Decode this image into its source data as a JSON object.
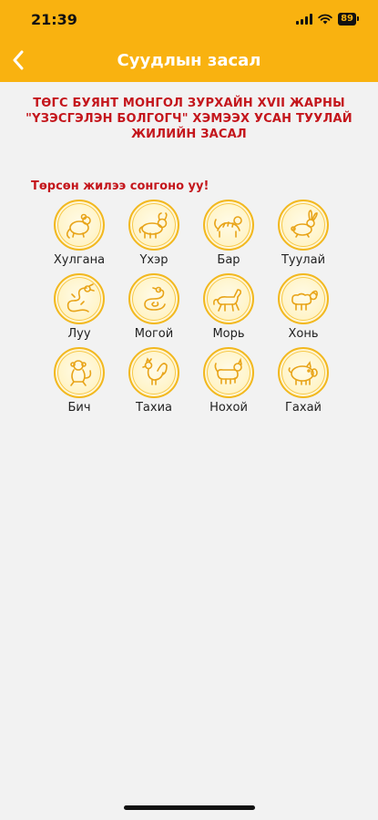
{
  "status_bar": {
    "time": "21:39",
    "battery": "89"
  },
  "nav": {
    "title": "Суудлын засал"
  },
  "heading": "ТӨГС БУЯНТ МОНГОЛ ЗУРХАЙН XVII ЖАРНЫ \"ҮЗЭСГЭЛЭН БОЛГОГЧ\" ХЭМЭЭХ УСАН ТУУЛАЙ ЖИЛИЙН ЗАСАЛ",
  "prompt": "Төрсөн жилээ сонгоно уу!",
  "colors": {
    "header": "#f9b210",
    "accent_red": "#c4161c",
    "coin_gold": "#f2b81f"
  },
  "animals": [
    {
      "label": "Хулгана",
      "icon": "mouse-icon"
    },
    {
      "label": "Үхэр",
      "icon": "ox-icon"
    },
    {
      "label": "Бар",
      "icon": "tiger-icon"
    },
    {
      "label": "Туулай",
      "icon": "rabbit-icon"
    },
    {
      "label": "Луу",
      "icon": "dragon-icon"
    },
    {
      "label": "Могой",
      "icon": "snake-icon"
    },
    {
      "label": "Морь",
      "icon": "horse-icon"
    },
    {
      "label": "Хонь",
      "icon": "sheep-icon"
    },
    {
      "label": "Бич",
      "icon": "monkey-icon"
    },
    {
      "label": "Тахиа",
      "icon": "rooster-icon"
    },
    {
      "label": "Нохой",
      "icon": "dog-icon"
    },
    {
      "label": "Гахай",
      "icon": "pig-icon"
    }
  ]
}
